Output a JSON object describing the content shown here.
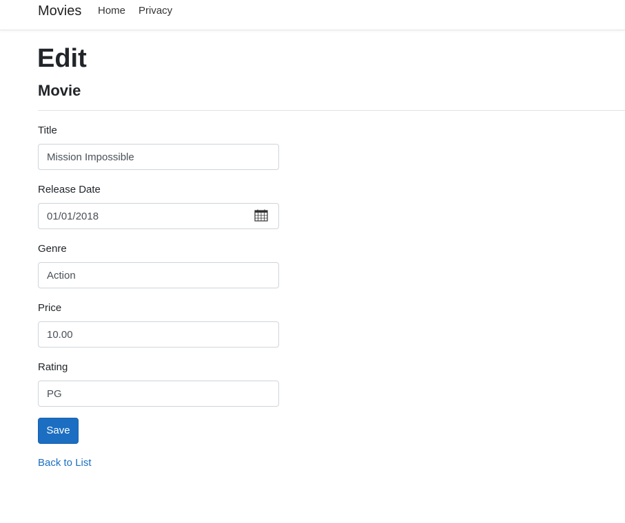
{
  "navbar": {
    "brand": "Movies",
    "links": [
      {
        "label": "Home"
      },
      {
        "label": "Privacy"
      }
    ]
  },
  "page": {
    "title": "Edit",
    "subtitle": "Movie"
  },
  "form": {
    "fields": [
      {
        "label": "Title",
        "value": "Mission Impossible"
      },
      {
        "label": "Release Date",
        "value": "01/01/2018",
        "icon": "calendar-icon"
      },
      {
        "label": "Genre",
        "value": "Action"
      },
      {
        "label": "Price",
        "value": "10.00"
      },
      {
        "label": "Rating",
        "value": "PG"
      }
    ],
    "save_label": "Save",
    "back_link": "Back to List"
  },
  "colors": {
    "primary": "#1b6ec2",
    "border": "#ced4da",
    "text": "#212529"
  }
}
